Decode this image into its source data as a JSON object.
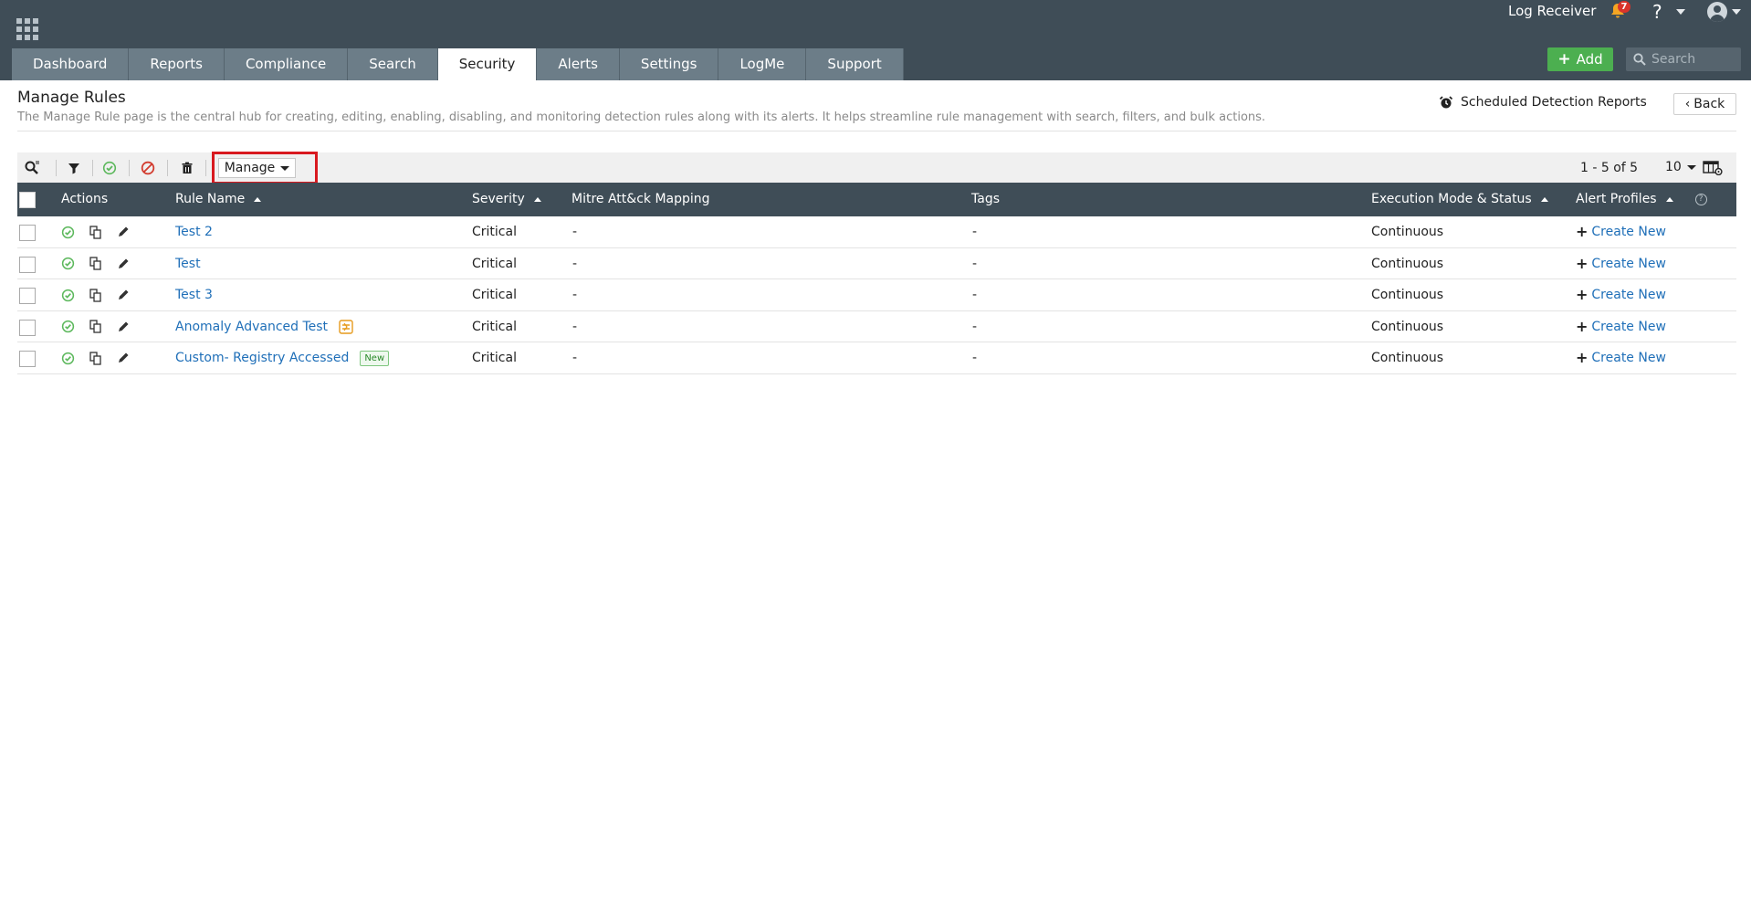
{
  "header": {
    "log_receiver": "Log Receiver",
    "notification_count": "7",
    "help": "?",
    "add_label": "Add",
    "search_placeholder": "Search"
  },
  "tabs": [
    {
      "label": "Dashboard"
    },
    {
      "label": "Reports"
    },
    {
      "label": "Compliance"
    },
    {
      "label": "Search"
    },
    {
      "label": "Security",
      "active": true
    },
    {
      "label": "Alerts"
    },
    {
      "label": "Settings"
    },
    {
      "label": "LogMe"
    },
    {
      "label": "Support"
    }
  ],
  "page": {
    "title": "Manage Rules",
    "description": "The Manage Rule page is the central hub for creating, editing, enabling, disabling, and monitoring detection rules along with its alerts. It helps streamline rule management with search, filters, and bulk actions.",
    "scheduled_reports": "Scheduled Detection Reports",
    "back": "Back"
  },
  "toolbar": {
    "manage": "Manage",
    "pager": "1 - 5 of 5",
    "page_size": "10"
  },
  "columns": {
    "actions": "Actions",
    "rule_name": "Rule Name",
    "severity": "Severity",
    "mitre": "Mitre Att&ck Mapping",
    "tags": "Tags",
    "execution": "Execution Mode & Status",
    "alert_profiles": "Alert Profiles"
  },
  "rows": [
    {
      "name": "Test 2",
      "severity": "Critical",
      "mitre": "-",
      "tags": "-",
      "execution": "Continuous",
      "alert": "Create New",
      "badge": ""
    },
    {
      "name": "Test",
      "severity": "Critical",
      "mitre": "-",
      "tags": "-",
      "execution": "Continuous",
      "alert": "Create New",
      "badge": ""
    },
    {
      "name": "Test 3",
      "severity": "Critical",
      "mitre": "-",
      "tags": "-",
      "execution": "Continuous",
      "alert": "Create New",
      "badge": ""
    },
    {
      "name": "Anomaly Advanced Test",
      "severity": "Critical",
      "mitre": "-",
      "tags": "-",
      "execution": "Continuous",
      "alert": "Create New",
      "badge": "",
      "anomaly_icon": true
    },
    {
      "name": "Custom- Registry Accessed",
      "severity": "Critical",
      "mitre": "-",
      "tags": "-",
      "execution": "Continuous",
      "alert": "Create New",
      "badge": "New"
    }
  ],
  "colors": {
    "header_bg": "#3f4d57",
    "tab_bg": "#6c7d88",
    "add_green": "#4caf50",
    "link_blue": "#1f6fb8",
    "highlight_red": "#d8191f"
  }
}
